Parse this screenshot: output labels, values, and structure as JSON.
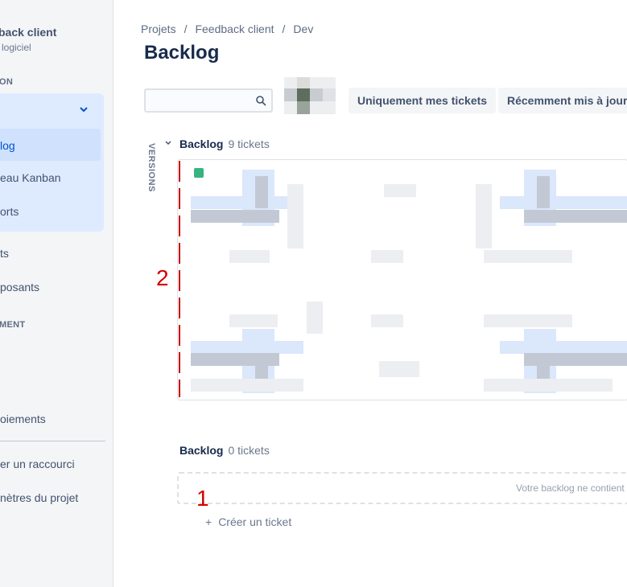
{
  "sidebar": {
    "project_name": "back client",
    "project_type": "logiciel",
    "section_planning": "ON",
    "nav_group": [
      {
        "label": "log",
        "active": true
      },
      {
        "label": "eau Kanban",
        "active": false
      },
      {
        "label": "orts",
        "active": false
      }
    ],
    "items_a": [
      "ts",
      "posants"
    ],
    "section_dev": "MENT",
    "items_b": [
      "oiements"
    ],
    "footer": [
      "er un raccourci",
      "nètres du projet"
    ]
  },
  "breadcrumb": [
    "Projets",
    "Feedback client",
    "Dev"
  ],
  "page_title": "Backlog",
  "search": {
    "value": "",
    "placeholder": ""
  },
  "filters": [
    "Uniquement mes tickets",
    "Récemment mis à jour"
  ],
  "versions_label": "VERSIONS",
  "backlog1": {
    "title": "Backlog",
    "count": "9 tickets"
  },
  "backlog2": {
    "title": "Backlog",
    "count": "0 tickets"
  },
  "empty_message": "Votre backlog ne contient",
  "create_ticket": "Créer un ticket",
  "annotations": [
    "1",
    "2"
  ],
  "colors": {
    "accent": "#0052cc",
    "annotation": "#d40000",
    "sidebar_bg": "#f4f5f7"
  }
}
